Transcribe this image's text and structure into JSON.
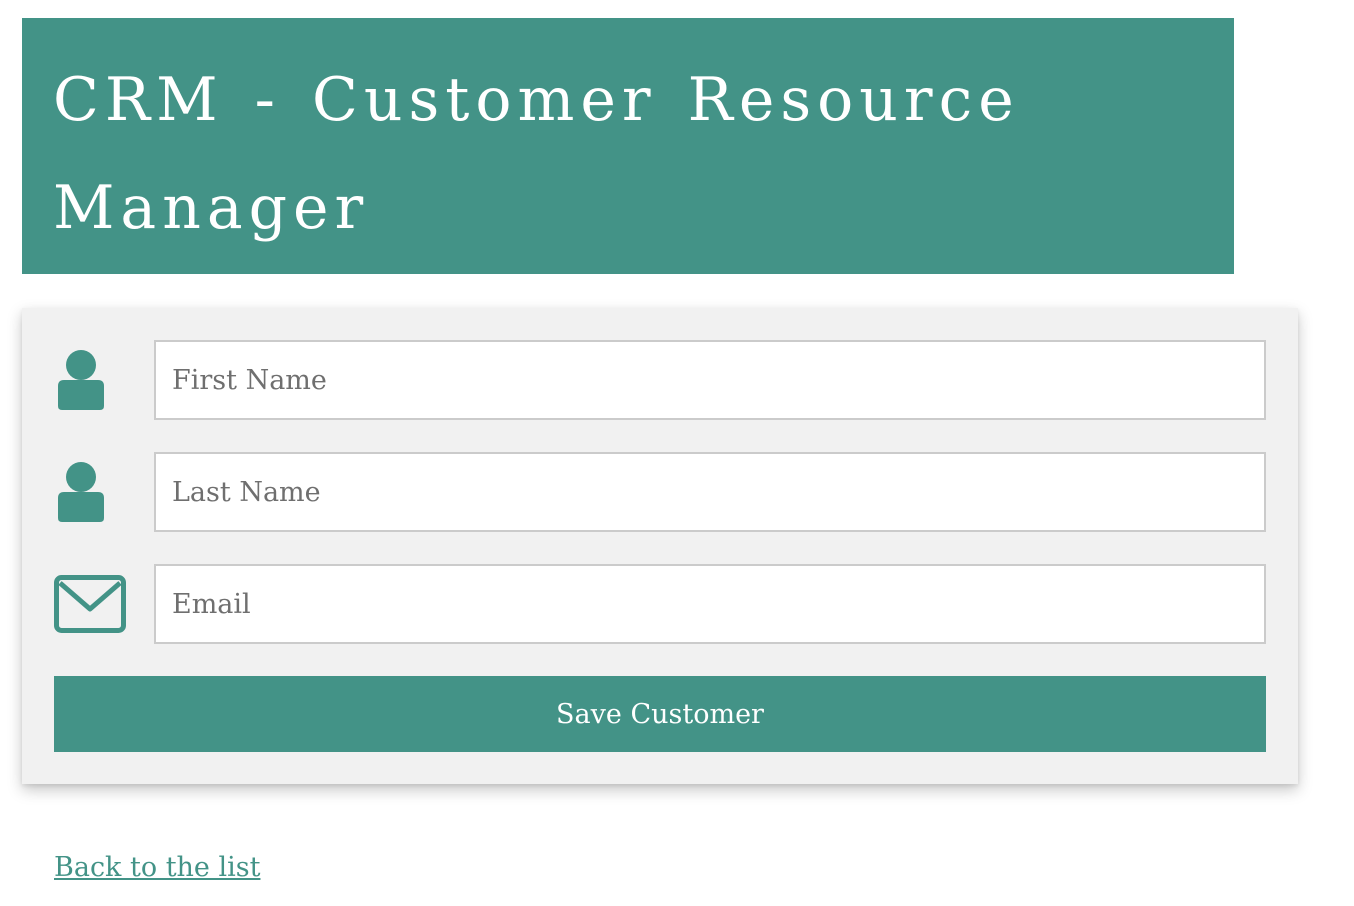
{
  "header": {
    "title": "CRM - Customer Resource Manager"
  },
  "form": {
    "fields": [
      {
        "icon": "user-icon",
        "placeholder": "First Name",
        "value": ""
      },
      {
        "icon": "user-icon",
        "placeholder": "Last Name",
        "value": ""
      },
      {
        "icon": "envelope-icon",
        "placeholder": "Email",
        "value": ""
      }
    ],
    "save_label": "Save Customer"
  },
  "links": {
    "back_label": "Back to the list"
  },
  "colors": {
    "accent": "#439387",
    "card_background": "#f1f1f1",
    "field_border": "#cbcbcb"
  }
}
